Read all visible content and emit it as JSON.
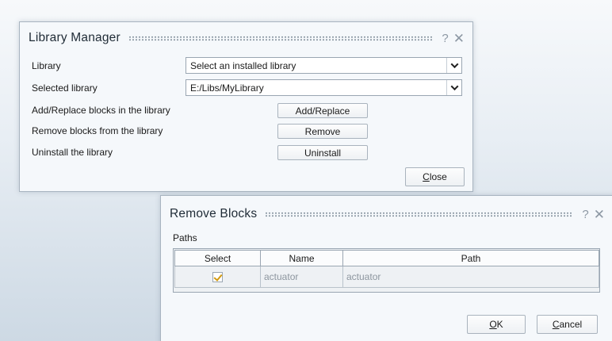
{
  "library_manager": {
    "title": "Library Manager",
    "help_icon": "?",
    "close_icon": "✕",
    "library_label": "Library",
    "library_value": "Select an installed library",
    "selected_library_label": "Selected library",
    "selected_library_value": "E:/Libs/MyLibrary",
    "add_replace_label": "Add/Replace blocks in the library",
    "add_replace_button": "Add/Replace",
    "remove_label": "Remove blocks from the library",
    "remove_button": "Remove",
    "uninstall_label": "Uninstall the library",
    "uninstall_button": "Uninstall",
    "close_button_prefix": "C",
    "close_button_rest": "lose"
  },
  "remove_blocks": {
    "title": "Remove Blocks",
    "help_icon": "?",
    "close_icon": "✕",
    "paths_label": "Paths",
    "columns": [
      "Select",
      "Name",
      "Path"
    ],
    "rows": [
      {
        "selected": true,
        "name": "actuator",
        "path": "actuator"
      }
    ],
    "ok_prefix": "O",
    "ok_rest": "K",
    "cancel_prefix": "C",
    "cancel_rest": "ancel"
  },
  "icons": {
    "dropdown": "chevron-down-icon",
    "help": "help-icon",
    "close": "close-icon",
    "checkbox": "checkmark-icon"
  },
  "colors": {
    "dialog_background": "#f5f8fb",
    "checkmark": "#d39a10",
    "border": "#9aa6b2"
  }
}
